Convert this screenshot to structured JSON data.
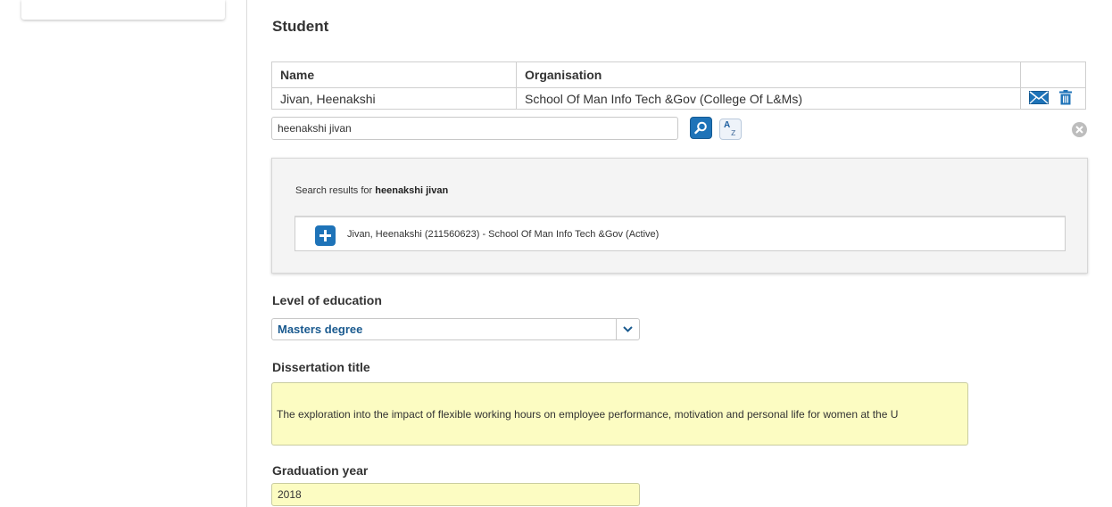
{
  "section": {
    "title": "Student"
  },
  "table": {
    "headers": [
      "Name",
      "Organisation"
    ],
    "rows": [
      {
        "name": "Jivan, Heenakshi",
        "organisation": "School Of Man Info Tech &Gov (College Of L&Ms)",
        "actions": [
          "mail-icon",
          "trash-icon"
        ]
      }
    ]
  },
  "search": {
    "value": "heenakshi jivan",
    "buttons": {
      "search": "search-icon",
      "sort": "sort-az-icon",
      "clear": "clear-icon"
    }
  },
  "results": {
    "prefix": "Search results for",
    "query": "heenakshi jivan",
    "items": [
      {
        "label": "Jivan, Heenakshi (211560623) - School Of Man Info Tech &Gov (Active)",
        "icon": "plus-icon"
      }
    ]
  },
  "education": {
    "label": "Level of education",
    "selected": "Masters degree"
  },
  "dissertation": {
    "label": "Dissertation title",
    "value": "The exploration into the impact of flexible working hours on employee performance, motivation and personal life for women at the U"
  },
  "graduation": {
    "label": "Graduation year",
    "value": "2018"
  },
  "colors": {
    "accent": "#1e73b8",
    "select_text": "#1a5a8f",
    "highlight_field": "#fcfcc2",
    "panel_bg": "#f4f4f4"
  }
}
